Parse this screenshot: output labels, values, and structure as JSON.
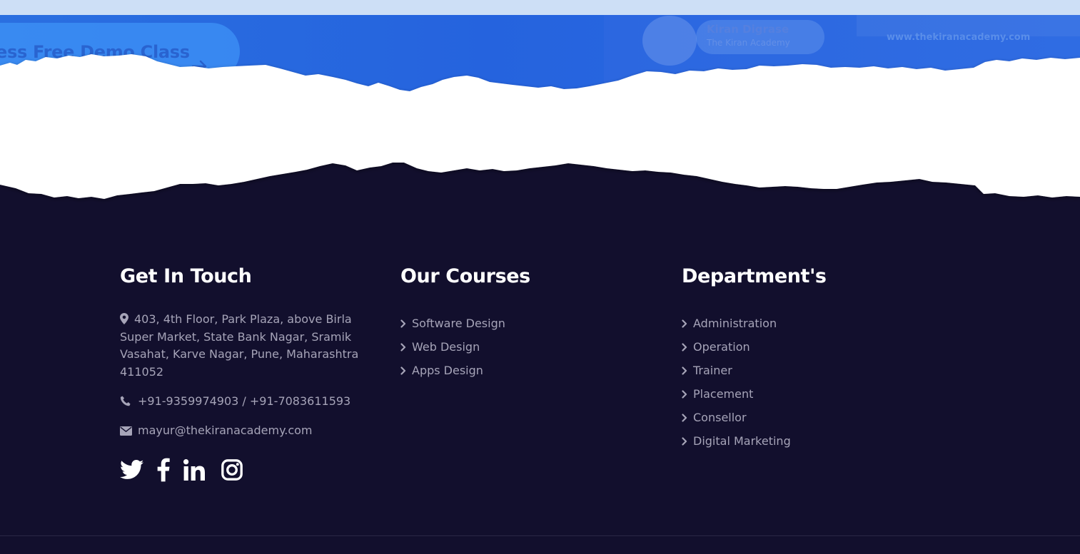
{
  "hero": {
    "demo_button_label": "ess Free Demo Class",
    "trainer_name": "Kiran Digrase",
    "trainer_org": "The Kiran Academy",
    "website": "www.thekiranacademy.com"
  },
  "colors": {
    "footer_bg": "#120f2d",
    "hero_blue": "#2563de",
    "link_text": "#a6a4b8",
    "heading_text": "#ffffff"
  },
  "footer": {
    "touch": {
      "heading": "Get In Touch",
      "address": "403, 4th Floor, Park Plaza, above Birla Super Market, State Bank Nagar, Sramik Vasahat, Karve Nagar, Pune, Maharashtra 411052",
      "phone": "+91-9359974903 / +91-7083611593",
      "email": "mayur@thekiranacademy.com",
      "address_icon": "map-marker-icon",
      "phone_icon": "phone-icon",
      "email_icon": "envelope-icon",
      "social": [
        "twitter-icon",
        "facebook-icon",
        "linkedin-icon",
        "instagram-icon"
      ]
    },
    "courses": {
      "heading": "Our Courses",
      "items": [
        "Software Design",
        "Web Design",
        "Apps Design"
      ]
    },
    "departments": {
      "heading": "Department's",
      "items": [
        "Administration",
        "Operation",
        "Trainer",
        "Placement",
        "Consellor",
        "Digital Marketing"
      ]
    }
  }
}
